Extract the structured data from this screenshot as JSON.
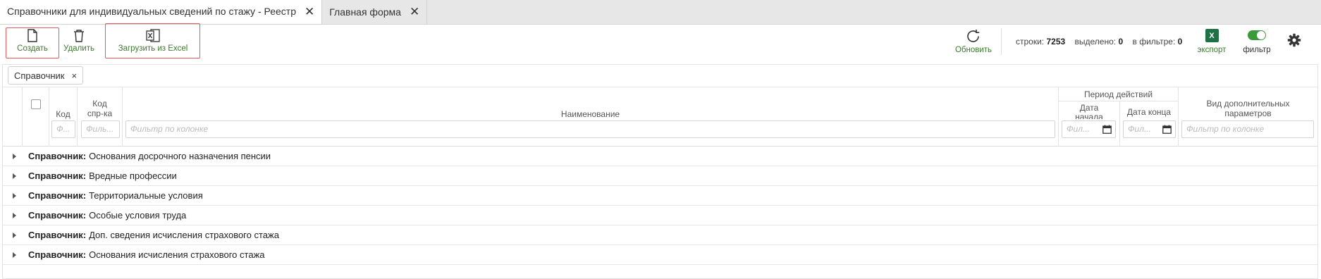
{
  "tabs": [
    {
      "label": "Справочники для индивидуальных сведений по стажу - Реестр"
    },
    {
      "label": "Главная форма"
    }
  ],
  "toolbar": {
    "create_label": "Создать",
    "delete_label": "Удалить",
    "import_label": "Загрузить из Excel",
    "refresh_label": "Обновить",
    "export_label": "экспорт",
    "filter_label": "фильтр",
    "export_icon_text": "X"
  },
  "stats": {
    "rows_label": "строки:",
    "rows_value": "7253",
    "selected_label": "выделено:",
    "selected_value": "0",
    "filtered_label": "в фильтре:",
    "filtered_value": "0"
  },
  "chip": {
    "label": "Справочник",
    "close": "×"
  },
  "columns": {
    "code": "Код",
    "ref_code_1": "Код",
    "ref_code_2": "спр-ка",
    "name": "Наименование",
    "period_group": "Период действий",
    "start_date_1": "Дата",
    "start_date_2": "начала",
    "end_date": "Дата конца",
    "extra_1": "Вид дополнительных",
    "extra_2": "параметров"
  },
  "filters": {
    "code_placeholder": "Ф...",
    "ref_code_placeholder": "Филь...",
    "name_placeholder": "Фильтр по колонке",
    "start_placeholder": "Фил...",
    "end_placeholder": "Фил...",
    "extra_placeholder": "Фильтр по колонке"
  },
  "group_label": "Справочник:",
  "rows": [
    {
      "value": "Основания досрочного назначения пенсии"
    },
    {
      "value": "Вредные профессии"
    },
    {
      "value": "Территориальные условия"
    },
    {
      "value": "Особые условия труда"
    },
    {
      "value": "Доп. сведения исчисления страхового стажа"
    },
    {
      "value": "Основания исчисления страхового стажа"
    }
  ],
  "colors": {
    "accent": "#3c7a2e",
    "highlight_box": "#e35a5a",
    "excel": "#1e7145"
  },
  "icons": [
    "file-icon",
    "trash-icon",
    "excel-import-icon",
    "refresh-icon",
    "excel-icon",
    "toggle-icon",
    "gear-icon",
    "calendar-icon",
    "close-icon",
    "expand-arrow-icon"
  ]
}
